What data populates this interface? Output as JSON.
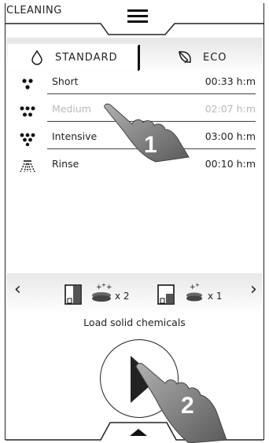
{
  "header": {
    "title": "CLEANING"
  },
  "modes": [
    {
      "label": "STANDARD",
      "icon": "drop-icon"
    },
    {
      "label": "ECO",
      "icon": "leaf-icon"
    }
  ],
  "programs": [
    {
      "name": "Short",
      "time": "00:33 h:m",
      "icon": "two-drops-icon"
    },
    {
      "name": "Medium",
      "time": "02:07 h:m",
      "icon": "three-drops-icon"
    },
    {
      "name": "Intensive",
      "time": "03:00 h:m",
      "icon": "four-drops-icon"
    },
    {
      "name": "Rinse",
      "time": "00:10 h:m",
      "icon": "shower-icon"
    }
  ],
  "chemicals": {
    "items": [
      {
        "quantity": "x 2",
        "icon": "tablet-icon"
      },
      {
        "quantity": "x 1",
        "icon": "tablet-icon"
      }
    ],
    "label": "Load solid chemicals"
  },
  "annotations": [
    "1",
    "2"
  ]
}
